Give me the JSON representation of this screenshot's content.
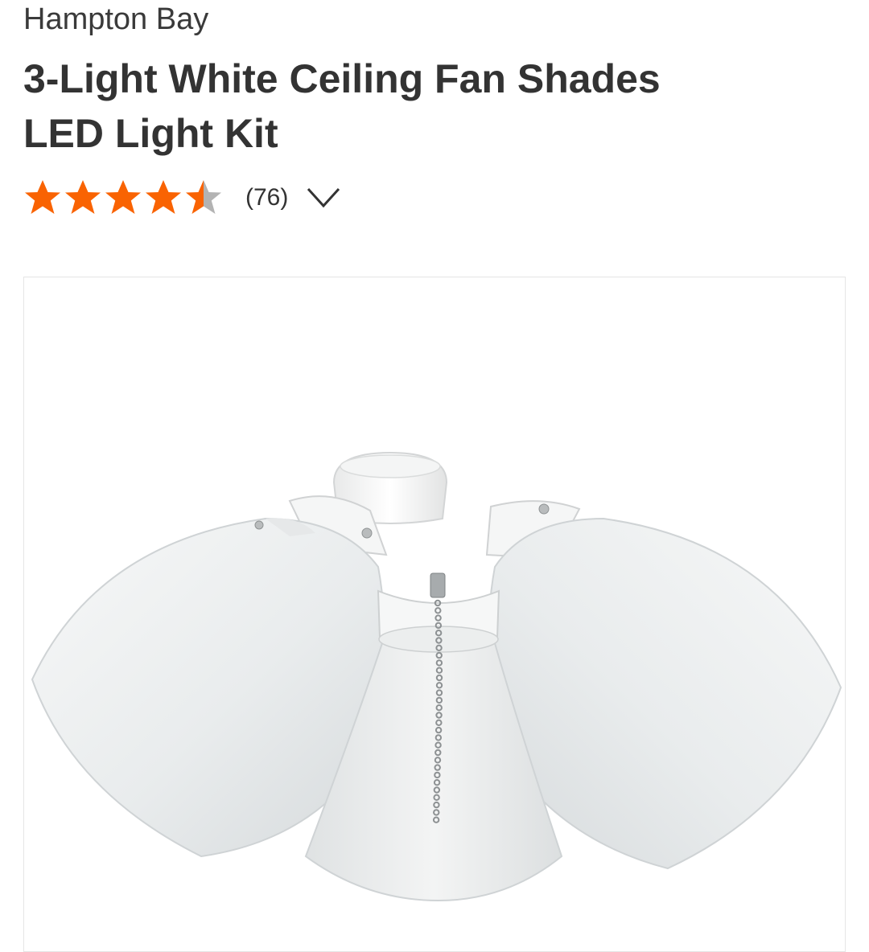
{
  "product": {
    "brand": "Hampton Bay",
    "title": "3-Light White Ceiling Fan Shades LED Light Kit",
    "rating": {
      "value": 4.5,
      "max": 5,
      "review_count": "(76)",
      "star_color": "#f96302",
      "empty_star_color": "#b3b3b3"
    },
    "image": {
      "alt": "3-Light White Ceiling Fan Shades LED Light Kit"
    }
  },
  "icons": {
    "expand_reviews": "chevron-down-icon",
    "star": "star-icon"
  }
}
